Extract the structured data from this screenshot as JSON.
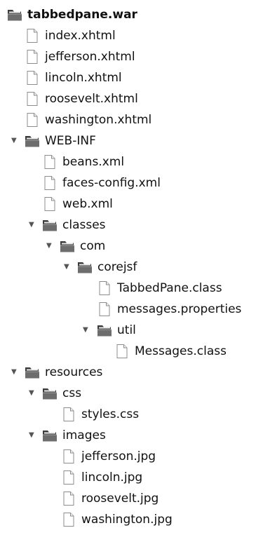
{
  "tree": {
    "root": "tabbedpane.war",
    "index": "index.xhtml",
    "jefferson": "jefferson.xhtml",
    "lincoln": "lincoln.xhtml",
    "roosevelt": "roosevelt.xhtml",
    "washington": "washington.xhtml",
    "webinf": "WEB-INF",
    "beans": "beans.xml",
    "faces_config": "faces-config.xml",
    "web": "web.xml",
    "classes": "classes",
    "com": "com",
    "corejsf": "corejsf",
    "tabbedpane_class": "TabbedPane.class",
    "messages_properties": "messages.properties",
    "util": "util",
    "messages_class": "Messages.class",
    "resources": "resources",
    "css": "css",
    "styles_css": "styles.css",
    "images": "images",
    "jefferson_jpg": "jefferson.jpg",
    "lincoln_jpg": "lincoln.jpg",
    "roosevelt_jpg": "roosevelt.jpg",
    "washington_jpg": "washington.jpg"
  },
  "icons": {
    "folder": "folder-icon",
    "file": "file-icon",
    "expanded_toggle": "expanded-triangle-icon"
  },
  "colors": {
    "folder_body": "#5f5f5f",
    "file_outline": "#8c8c8c"
  }
}
